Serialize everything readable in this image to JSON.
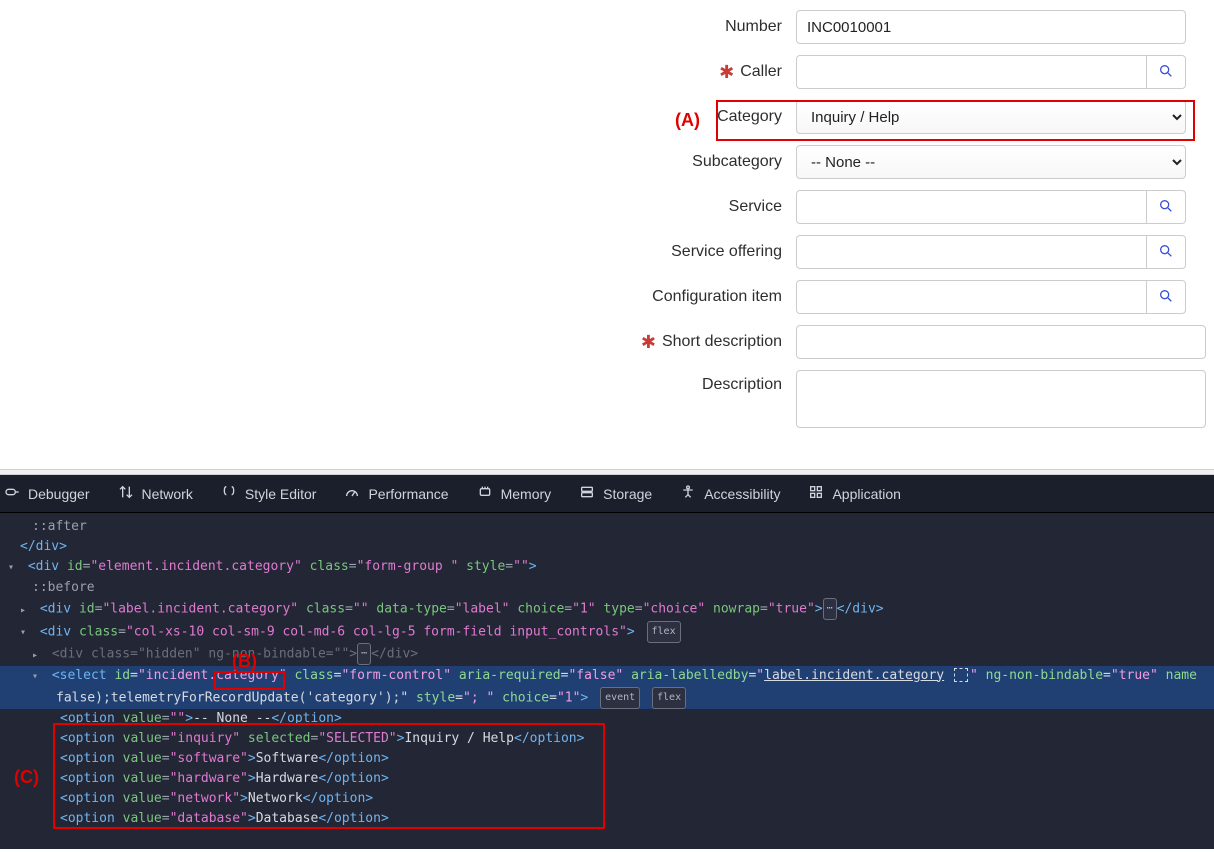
{
  "form": {
    "number": {
      "label": "Number",
      "value": "INC0010001"
    },
    "caller": {
      "label": "Caller",
      "value": ""
    },
    "category": {
      "label": "Category",
      "selected": "Inquiry / Help"
    },
    "subcategory": {
      "label": "Subcategory",
      "selected": "-- None --"
    },
    "service": {
      "label": "Service",
      "value": ""
    },
    "service_offering": {
      "label": "Service offering",
      "value": ""
    },
    "configuration_item": {
      "label": "Configuration item",
      "value": ""
    },
    "short_description": {
      "label": "Short description",
      "value": ""
    },
    "description": {
      "label": "Description",
      "value": ""
    },
    "required_mark": "✱"
  },
  "annotations": {
    "a": "(A)",
    "b": "(B)",
    "c": "(C)"
  },
  "devtools": {
    "tabs": {
      "debugger": "Debugger",
      "network": "Network",
      "style_editor": "Style Editor",
      "performance": "Performance",
      "memory": "Memory",
      "storage": "Storage",
      "accessibility": "Accessibility",
      "application": "Application"
    },
    "badges": {
      "flex": "flex",
      "event": "event",
      "dots": "⋯"
    },
    "code": {
      "pseudo_after": "::after",
      "close_div": "</div>",
      "line_div_elem": {
        "id": "element.incident.category",
        "class": "form-group ",
        "style": ""
      },
      "pseudo_before": "::before",
      "line_div_label": {
        "id": "label.incident.category",
        "class": "",
        "data_type": "label",
        "choice": "1",
        "type": "choice",
        "nowrap": "true"
      },
      "line_div_col": {
        "class": "col-xs-10 col-sm-9 col-md-6 col-lg-5 form-field input_controls"
      },
      "line_div_hidden": {
        "class": "hidden",
        "attr": "ng-non-bindable",
        "extra": "=\"\""
      },
      "line_select": {
        "id": "incident.category",
        "class": "form-control",
        "aria_required": "false",
        "aria_labelledby": "label.incident.category",
        "ng_non_bindable": "true",
        "name_frag": "name",
        "line2": "false);telemetryForRecordUpdate('category');\"",
        "style": "; ",
        "choice": "1"
      },
      "options": [
        {
          "value": "",
          "text": "-- None --",
          "selected": false
        },
        {
          "value": "inquiry",
          "text": "Inquiry / Help",
          "selected": true
        },
        {
          "value": "software",
          "text": "Software",
          "selected": false
        },
        {
          "value": "hardware",
          "text": "Hardware",
          "selected": false
        },
        {
          "value": "network",
          "text": "Network",
          "selected": false
        },
        {
          "value": "database",
          "text": "Database",
          "selected": false
        }
      ]
    }
  }
}
